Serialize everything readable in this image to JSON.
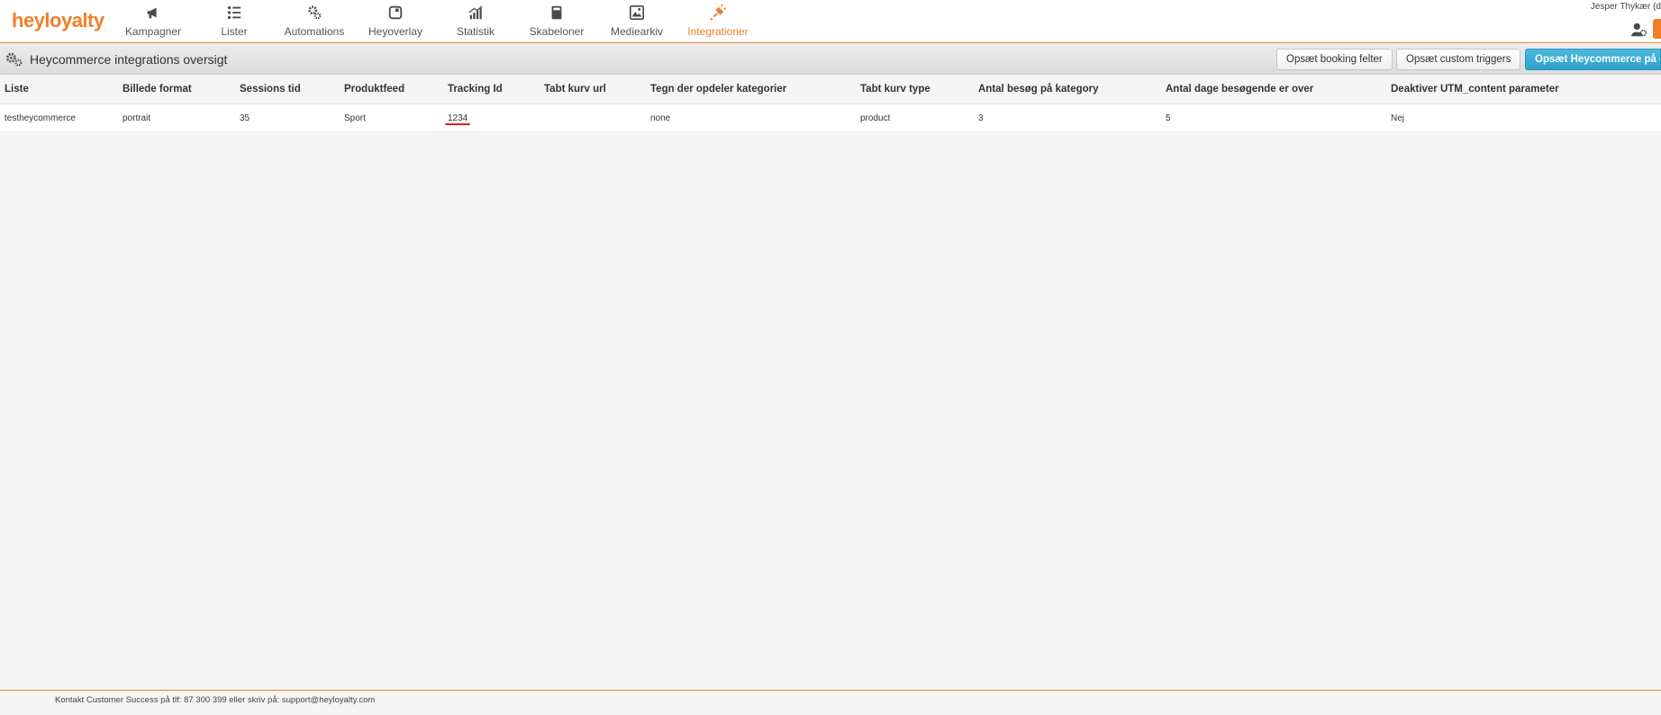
{
  "app": {
    "logo_main": "heyloyalty",
    "logo_suffix": ".",
    "brand_color": "#f07f2b",
    "user_name": "Jesper Thykær (d"
  },
  "nav": {
    "items": [
      {
        "label": "Kampagner",
        "icon": "megaphone-icon"
      },
      {
        "label": "Lister",
        "icon": "list-icon"
      },
      {
        "label": "Automations",
        "icon": "cogs-icon"
      },
      {
        "label": "Heyoverlay",
        "icon": "overlay-icon"
      },
      {
        "label": "Statistik",
        "icon": "chart-icon"
      },
      {
        "label": "Skabeloner",
        "icon": "template-icon"
      },
      {
        "label": "Mediearkiv",
        "icon": "image-icon"
      },
      {
        "label": "Integrationer",
        "icon": "plug-icon",
        "active": true
      }
    ]
  },
  "header": {
    "title": "Heycommerce integrations oversigt",
    "buttons": {
      "booking": "Opsæt booking felter",
      "triggers": "Opsæt custom triggers",
      "setup": "Opsæt Heycommerce på en"
    }
  },
  "table": {
    "columns": [
      "Liste",
      "Billede format",
      "Sessions tid",
      "Produktfeed",
      "Tracking Id",
      "Tabt kurv url",
      "Tegn der opdeler kategorier",
      "Tabt kurv type",
      "Antal besøg på kategory",
      "Antal dage besøgende er over",
      "Deaktiver UTM_content parameter"
    ],
    "rows": [
      [
        "testheycommerce",
        "portrait",
        "35",
        "Sport",
        "1234",
        "",
        "none",
        "product",
        "3",
        "5",
        "Nej"
      ]
    ]
  },
  "footer": {
    "text": "Kontakt Customer Success på tlf: 87 300 399 eller skriv på: support@heyloyalty.com"
  }
}
